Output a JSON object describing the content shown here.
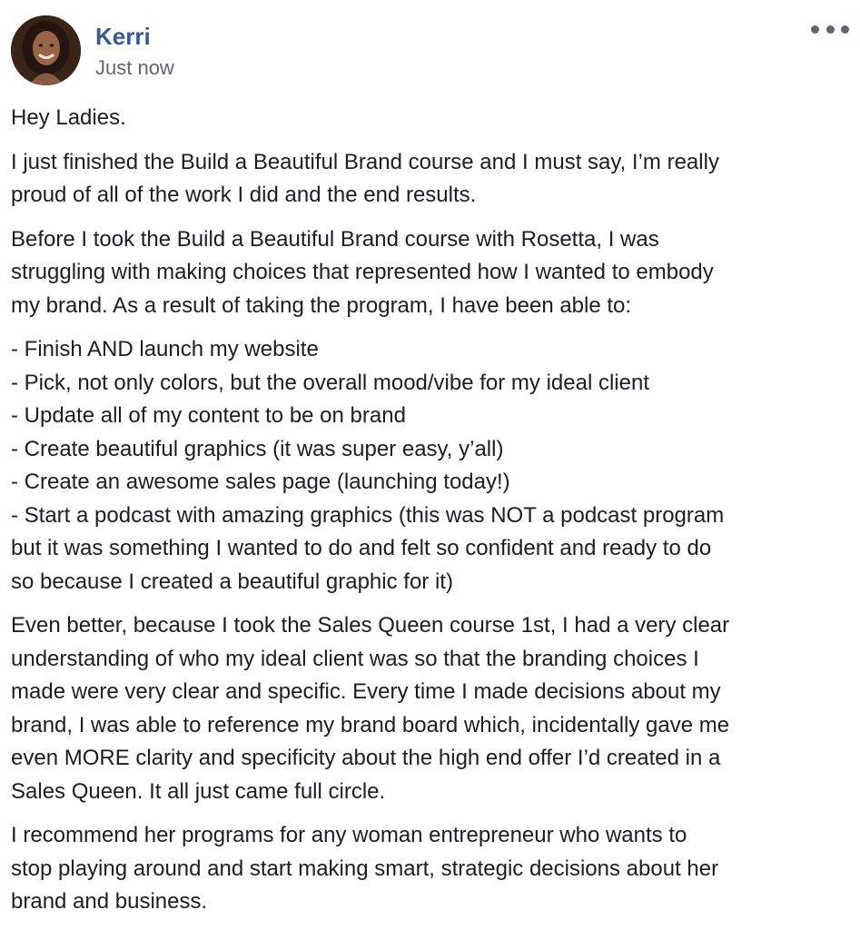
{
  "post": {
    "author": "Kerri",
    "timestamp": "Just now",
    "more_icon": "ellipsis-icon",
    "avatar_icon": "profile-photo",
    "colors": {
      "author": "#385898",
      "timestamp": "#616770",
      "text": "#1c1e21"
    },
    "paragraphs": [
      {
        "lines": [
          "Hey Ladies."
        ]
      },
      {
        "lines": [
          "I just finished the Build a Beautiful Brand course and I must say, I’m really",
          "proud of all of the work I did and the end results."
        ]
      },
      {
        "lines": [
          "Before I took the Build a Beautiful Brand course with Rosetta, I was",
          "struggling with making choices that represented how I wanted to embody",
          "my brand. As a result of taking the program, I have been able to:"
        ]
      },
      {
        "lines": [
          "- Finish AND launch my website",
          "- Pick, not only colors, but the overall mood/vibe for my ideal client",
          "- Update all of my content to be on brand",
          "- Create beautiful graphics (it was super easy, y’all)",
          "- Create an awesome sales page (launching today!)",
          "- Start a podcast with amazing graphics (this was NOT a podcast program",
          "but it was something I wanted to do and felt so confident and ready to do",
          "so because I created a beautiful graphic for it)"
        ]
      },
      {
        "lines": [
          "Even better, because I took the Sales Queen course 1st, I had a very clear",
          "understanding of who my ideal client was so that the branding choices I",
          "made were very clear and specific. Every time I made decisions about my",
          "brand, I was able to reference my brand board which, incidentally gave me",
          "even MORE clarity and specificity about the high end offer I’d created in a",
          "Sales Queen. It all just came full circle."
        ]
      },
      {
        "lines": [
          "I recommend her programs for any woman entrepreneur who wants to",
          "stop playing around and start making smart, strategic decisions about her",
          "brand and business."
        ]
      }
    ]
  }
}
